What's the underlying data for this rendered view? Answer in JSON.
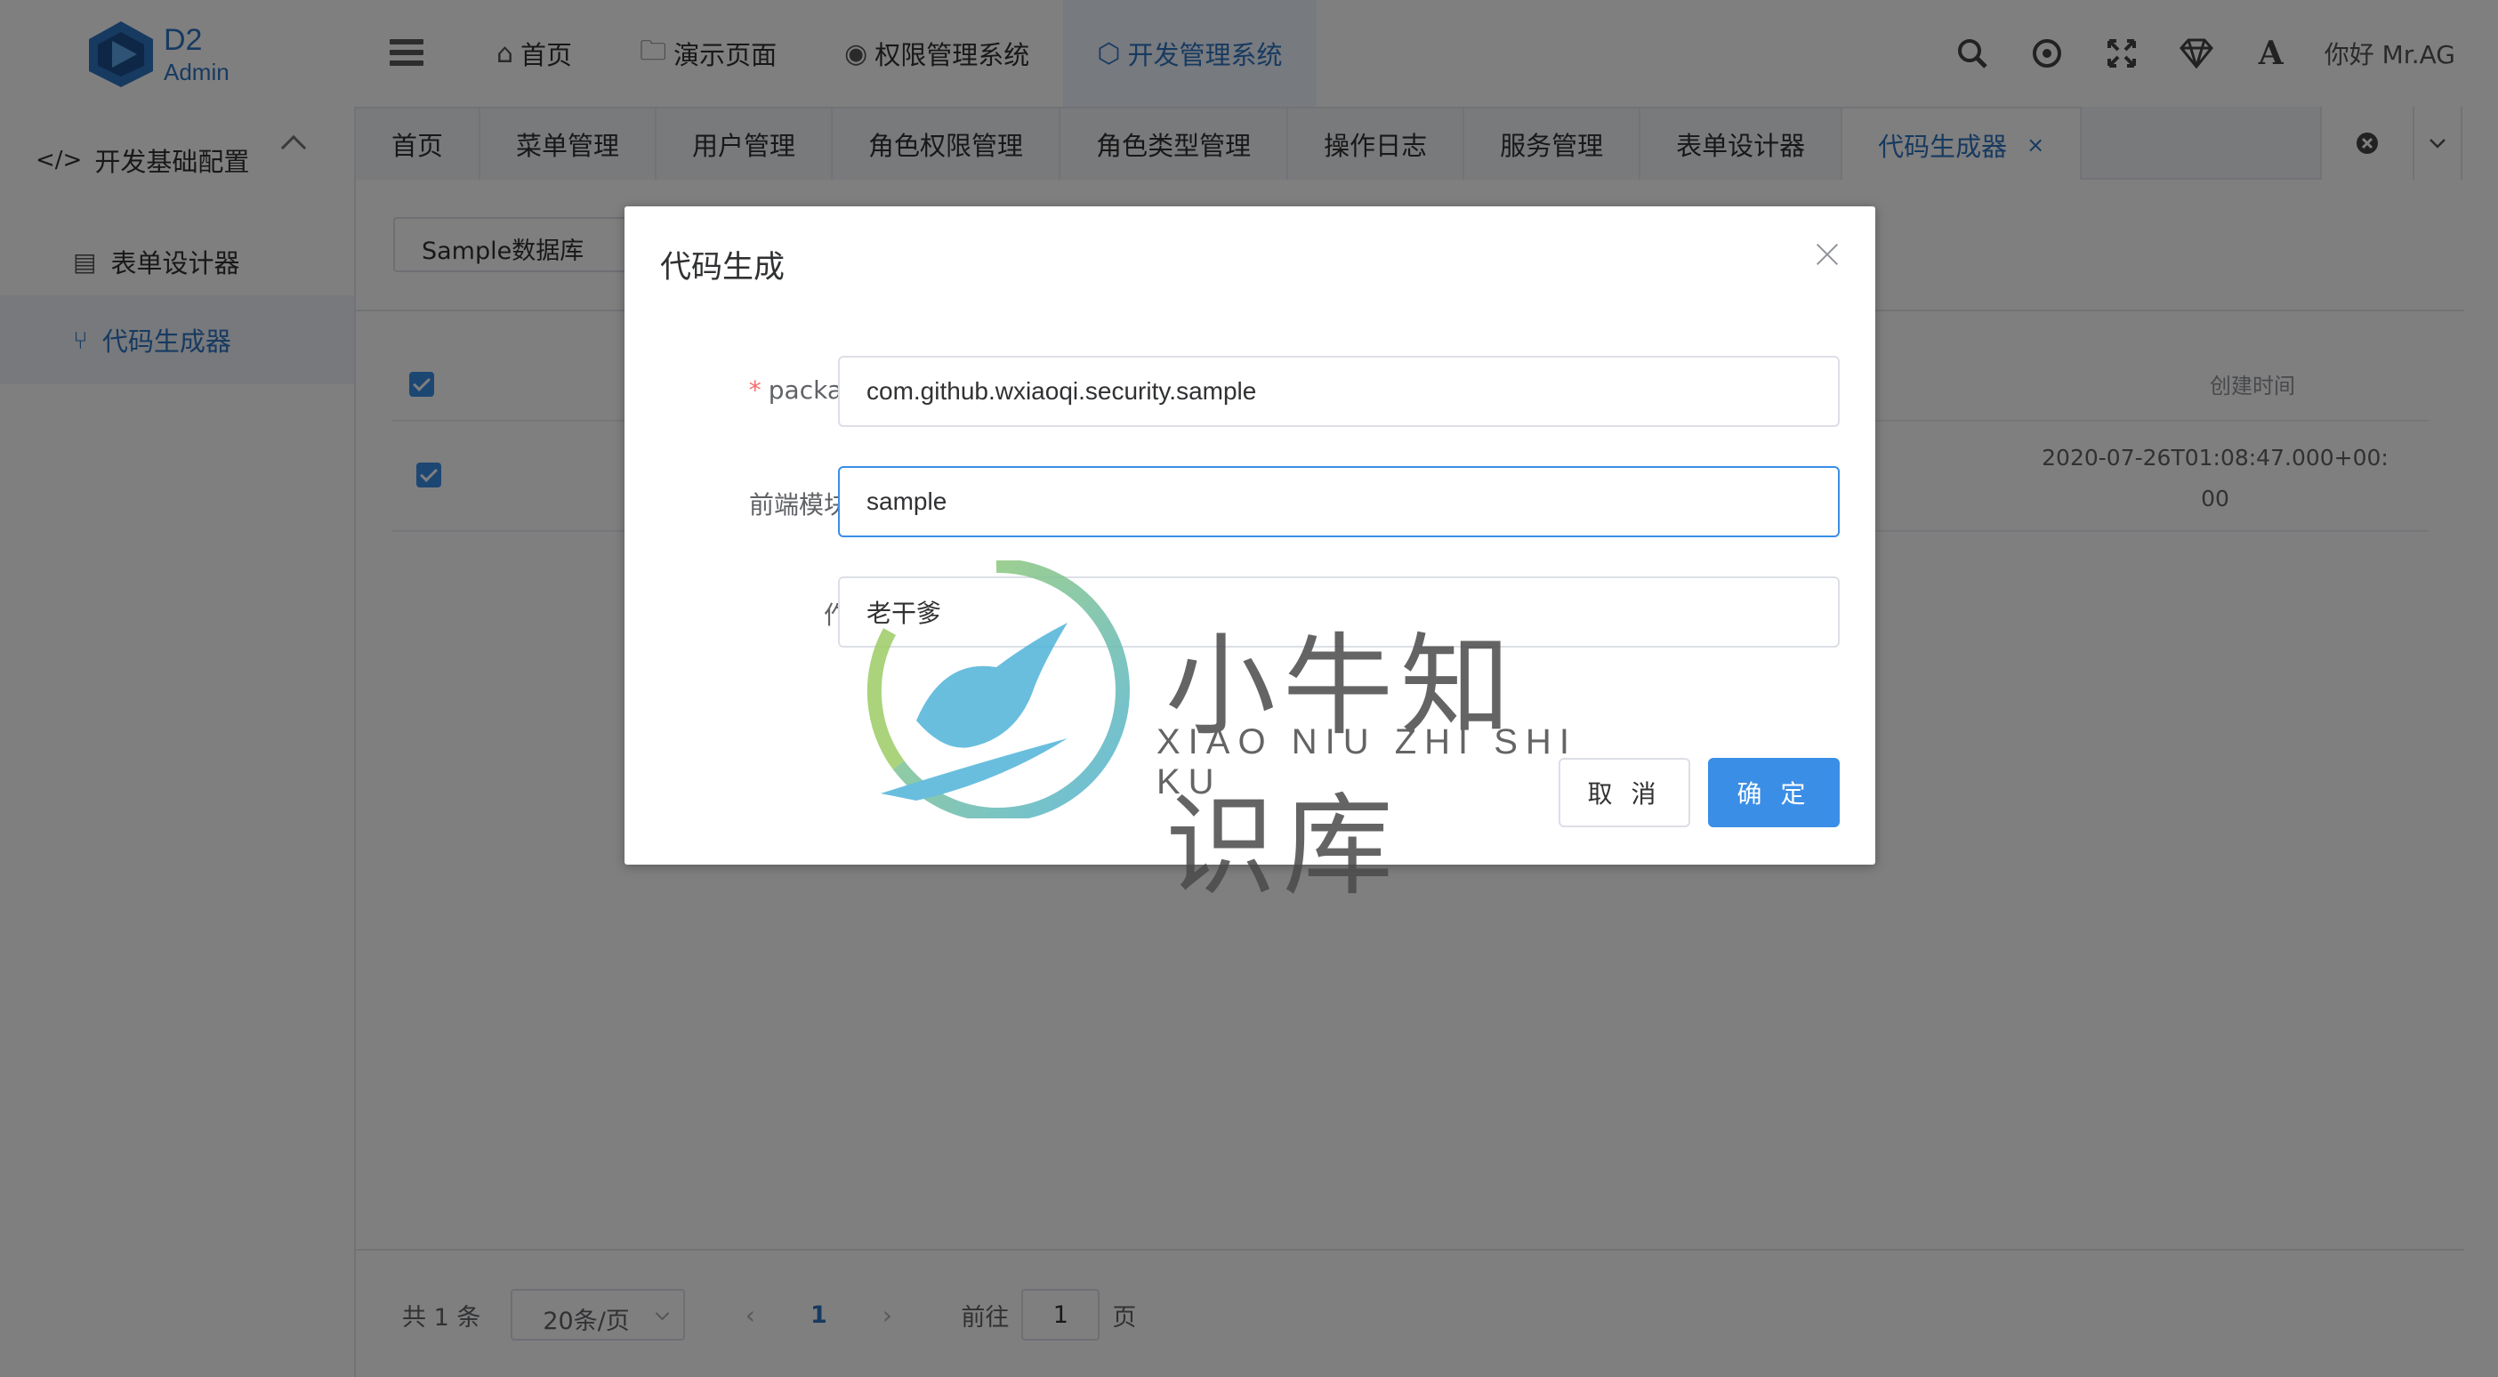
{
  "header": {
    "logo": {
      "line1": "D2",
      "line2": "Admin"
    },
    "nav": [
      {
        "label": "首页",
        "icon": "home-icon"
      },
      {
        "label": "演示页面",
        "icon": "folder-icon"
      },
      {
        "label": "权限管理系统",
        "icon": "chrome-icon"
      },
      {
        "label": "开发管理系统",
        "icon": "hexagon-icon",
        "active": true
      }
    ],
    "icons": [
      "search-icon",
      "target-icon",
      "fullscreen-icon",
      "diamond-icon",
      "font-size-icon"
    ],
    "user": "你好 Mr.AG"
  },
  "sidebar": {
    "group": "开发基础配置",
    "items": [
      {
        "label": "表单设计器",
        "icon": "form-icon"
      },
      {
        "label": "代码生成器",
        "icon": "branch-icon",
        "active": true
      }
    ]
  },
  "tabs": [
    {
      "label": "首页"
    },
    {
      "label": "菜单管理"
    },
    {
      "label": "用户管理"
    },
    {
      "label": "角色权限管理"
    },
    {
      "label": "角色类型管理"
    },
    {
      "label": "操作日志"
    },
    {
      "label": "服务管理"
    },
    {
      "label": "表单设计器"
    },
    {
      "label": "代码生成器",
      "active": true,
      "close": "×"
    }
  ],
  "main": {
    "db_select": "Sample数据库",
    "table": {
      "columns": {
        "created": "创建时间"
      },
      "rows": [
        {
          "created_line1": "2020-07-26T01:08:47.000+00:",
          "created_line2": "00"
        }
      ]
    },
    "pager": {
      "total": "共 1 条",
      "page_size": "20条/页",
      "current": "1",
      "goto_prefix": "前往",
      "goto_value": "1",
      "goto_suffix": "页"
    }
  },
  "dialog": {
    "title": "代码生成",
    "fields": {
      "package": {
        "label": "package",
        "value": "com.github.wxiaoqi.security.sample",
        "required": true
      },
      "module": {
        "label": "前端模块名",
        "value": "sample"
      },
      "author": {
        "label": "作者",
        "value": "老干爹"
      }
    },
    "cancel_label": "取 消",
    "ok_label": "确 定"
  },
  "watermark": {
    "cn": "小牛知识库",
    "en": "XIAO NIU ZHI SHI KU"
  },
  "colors": {
    "accent": "#3a8ee6",
    "brand": "#2f74c0",
    "required": "#f56c6c"
  }
}
